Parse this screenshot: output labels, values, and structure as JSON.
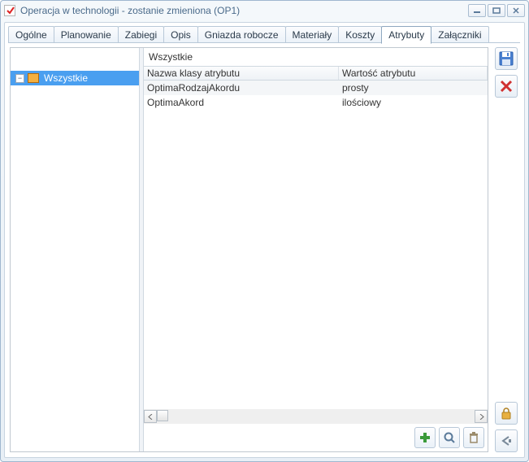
{
  "window": {
    "title": "Operacja w technologii - zostanie zmieniona  (OP1)"
  },
  "tabs": [
    {
      "label": "Ogólne"
    },
    {
      "label": "Planowanie"
    },
    {
      "label": "Zabiegi"
    },
    {
      "label": "Opis"
    },
    {
      "label": "Gniazda robocze"
    },
    {
      "label": "Materiały"
    },
    {
      "label": "Koszty"
    },
    {
      "label": "Atrybuty",
      "active": true
    },
    {
      "label": "Załączniki"
    }
  ],
  "tree": {
    "root_label": "Wszystkie",
    "expander": "−"
  },
  "list_header": "Wszystkie",
  "grid": {
    "columns": [
      {
        "label": "Nazwa klasy atrybutu"
      },
      {
        "label": "Wartość atrybutu"
      }
    ],
    "rows": [
      {
        "name": "OptimaRodzajAkordu",
        "value": "prosty"
      },
      {
        "name": "OptimaAkord",
        "value": "ilościowy"
      }
    ]
  }
}
